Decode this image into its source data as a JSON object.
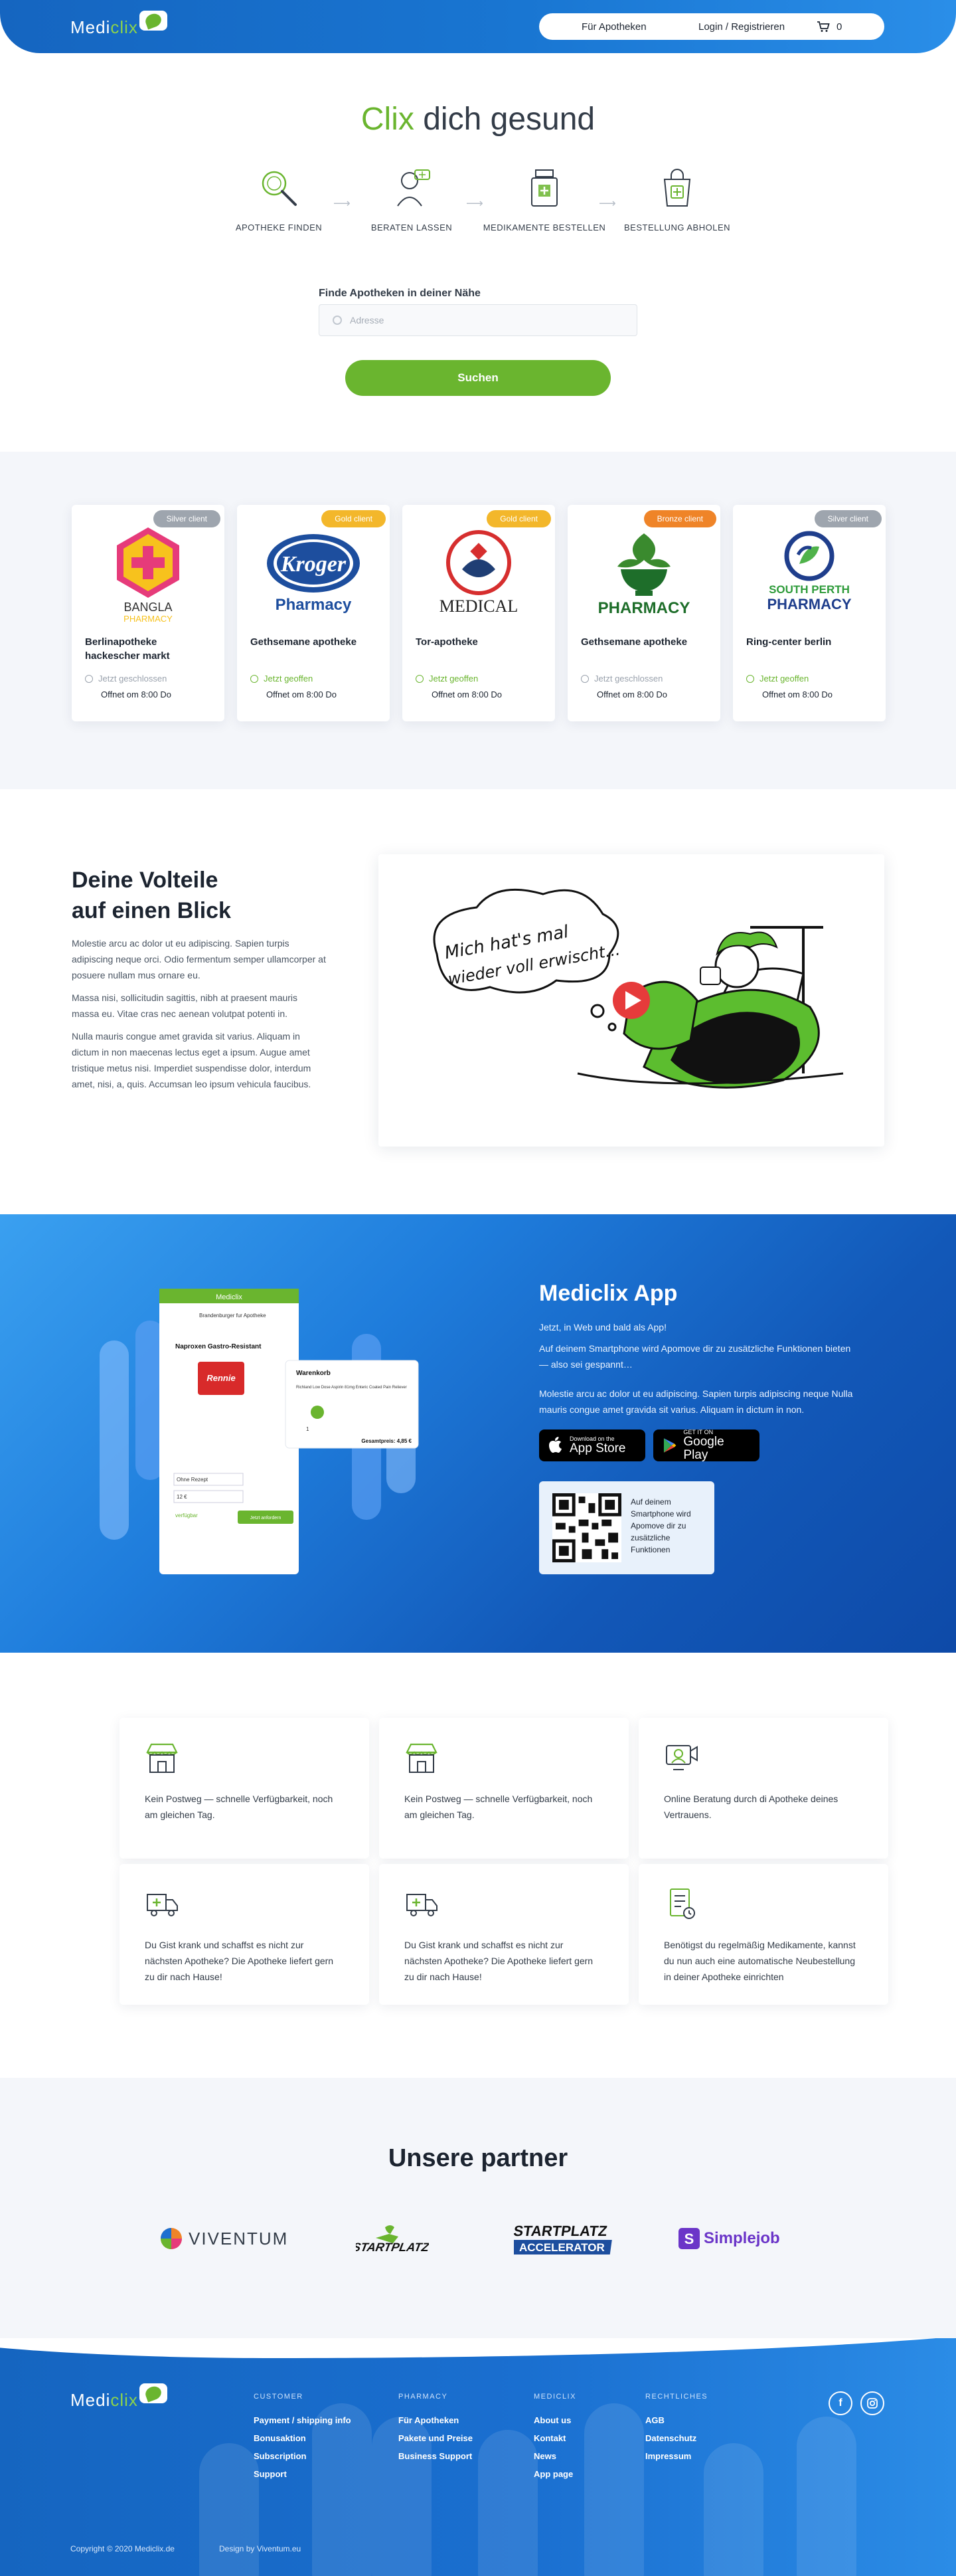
{
  "header": {
    "logo_part1": "Medi",
    "logo_part2": "clix",
    "nav_pharmacies": "Für Apotheken",
    "nav_login": "Login / Registrieren",
    "cart_count": "0"
  },
  "hero": {
    "title_green": "Clix",
    "title_rest": "dich gesund",
    "steps": [
      {
        "label": "APOTHEKE FINDEN",
        "icon": "magnifier-icon"
      },
      {
        "label": "BERATEN LASSEN",
        "icon": "pharmacist-icon"
      },
      {
        "label": "MEDIKAMENTE BESTELLEN",
        "icon": "medicine-icon"
      },
      {
        "label": "BESTELLUNG ABHOLEN",
        "icon": "shopping-bag-icon"
      }
    ],
    "search_label": "Finde Apotheken in deiner Nähe",
    "search_placeholder": "Adresse",
    "search_button": "Suchen"
  },
  "pharmacies": [
    {
      "tag": "Silver client",
      "tag_type": "silver",
      "logo_text": "BANGLA",
      "logo_text2": "PHARMACY",
      "name": "Berlinapotheke hackescher markt",
      "status": "Jetzt geschlossen",
      "status_type": "closed",
      "opens": "Offnet om 8:00 Do"
    },
    {
      "tag": "Gold client",
      "tag_type": "gold",
      "logo_text": "Kroger",
      "logo_text2": "Pharmacy",
      "name": "Gethsemane apotheke",
      "status": "Jetzt geoffen",
      "status_type": "open",
      "opens": "Offnet om 8:00 Do"
    },
    {
      "tag": "Gold client",
      "tag_type": "gold",
      "logo_text": "MEDICAL",
      "logo_text2": "",
      "name": "Tor-apotheke",
      "status": "Jetzt geoffen",
      "status_type": "open",
      "opens": "Offnet om 8:00 Do"
    },
    {
      "tag": "Bronze client",
      "tag_type": "bronze",
      "logo_text": "PHARMACY",
      "logo_text2": "",
      "name": "Gethsemane apotheke",
      "status": "Jetzt geschlossen",
      "status_type": "closed",
      "opens": "Offnet om 8:00 Do"
    },
    {
      "tag": "Silver client",
      "tag_type": "silver",
      "logo_text": "SOUTH PERTH",
      "logo_text2": "PHARMACY",
      "name": "Ring-center berlin",
      "status": "Jetzt geoffen",
      "status_type": "open",
      "opens": "Offnet om 8:00 Do"
    }
  ],
  "advantages": {
    "title_line1": "Deine Volteile",
    "title_line2": "auf einen Blick",
    "p1": "Molestie arcu ac dolor ut eu adipiscing. Sapien turpis adipiscing neque orci. Odio fermentum semper ullamcorper at posuere nullam mus ornare eu.",
    "p2": "Massa nisi, sollicitudin sagittis, nibh at praesent mauris massa eu. Vitae cras nec aenean volutpat potenti in.",
    "p3": " Nulla mauris congue amet gravida sit varius. Aliquam in dictum in non maecenas lectus eget a ipsum. Augue amet tristique metus nisi. Imperdiet suspendisse dolor, interdum amet, nisi, a, quis. Accumsan leo ipsum vehicula faucibus.",
    "video_caption_line1": "Mich hat's mal",
    "video_caption_line2": "wieder voll erwischt..."
  },
  "app": {
    "title": "Mediclix App",
    "p1": "Jetzt, in Web und bald als App!",
    "p2": "Auf deinem Smartphone wird Apomove dir zu zusätzliche Funktionen bieten — also sei gespannt…",
    "p3": "Molestie arcu ac dolor ut eu adipiscing. Sapien turpis adipiscing neque Nulla mauris congue amet gravida sit varius. Aliquam in dictum in non.",
    "appstore_small": "Download on the",
    "appstore_big": "App Store",
    "googleplay_small": "GET IT ON",
    "googleplay_big": "Google Play",
    "qr_text": "Auf deinem Smartphone wird Apomove dir zu zusätzliche Funktionen",
    "mock": {
      "brand": "Mediclix",
      "pharmacy": "Brandenburger fur Apotheke",
      "product": "Naproxen Gastro-Resistant",
      "product_box": "Rennie",
      "cart_title": "Warenkorb",
      "cart_item": "Richland Low Dose Aspirin 81mg Enteric Coated Pain Reliever",
      "total_label": "Gesamtpreis: 4,85 €",
      "qty": "1",
      "variant": "Ohne Rezept",
      "price": "12 €",
      "submit": "Jetzt anfordern",
      "link": "verfügbar"
    }
  },
  "features": [
    {
      "icon": "storefront-icon",
      "text": "Kein Postweg — schnelle Verfügbarkeit, noch am gleichen Tag."
    },
    {
      "icon": "storefront-icon",
      "text": "Kein Postweg — schnelle Verfügbarkeit, noch am gleichen Tag."
    },
    {
      "icon": "video-consultation-icon",
      "text": "Online Beratung durch di Apotheke deines Vertrauens."
    },
    {
      "icon": "delivery-truck-icon",
      "text": "Du Gist krank und schaffst es nicht zur nächsten Apotheke? Die Apotheke liefert gern zu dir nach Hause!"
    },
    {
      "icon": "delivery-truck-icon",
      "text": "Du Gist krank und schaffst es nicht zur nächsten Apotheke? Die Apotheke liefert gern zu dir nach Hause!"
    },
    {
      "icon": "prescription-icon",
      "text": "Benötigst du regelmäßig Medikamente, kannst du nun auch eine automatische Neubestellung in deiner Apotheke einrichten"
    }
  ],
  "partners": {
    "title": "Unsere partner",
    "logos": [
      "VIVENTUM",
      "STARTPLATZ",
      "STARTPLATZ",
      "ACCELERATOR",
      "Simplejob"
    ]
  },
  "footer": {
    "col1_head": "CUSTOMER",
    "col1_links": [
      "Payment / shipping info",
      "Bonusaktion",
      "Subscription",
      "Support"
    ],
    "col2_head": "PHARMACY",
    "col2_links": [
      "Für Apotheken",
      "Pakete und Preise",
      "Business Support"
    ],
    "col3_head": "MEDICLIX",
    "col3_links": [
      "About us",
      "Kontakt",
      "News",
      "App page"
    ],
    "col4_head": "RECHTLICHES",
    "col4_links": [
      "AGB",
      "Datenschutz",
      "Impressum"
    ],
    "social_facebook": "f",
    "copyright": "Copyright © 2020 Mediclix.de",
    "design": "Design by Viventum.eu"
  },
  "colors": {
    "primary_blue": "#1565c0",
    "brand_green": "#6ab52f",
    "gold": "#f3b72b",
    "bronze": "#ef8428",
    "silver": "#9ea5ae"
  }
}
